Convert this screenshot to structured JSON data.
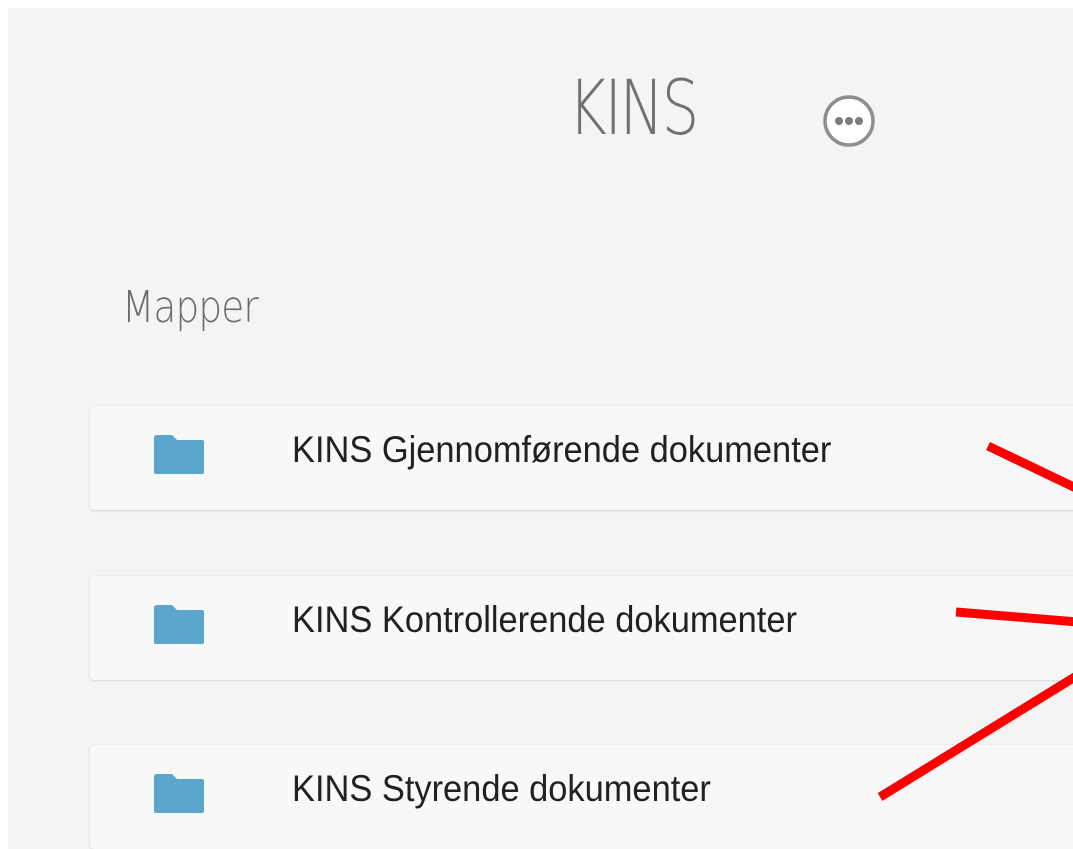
{
  "header": {
    "title": "KINS",
    "more_icon": "more-horizontal-circle-icon"
  },
  "folders_section": {
    "heading": "Mapper",
    "items": [
      {
        "label": "KINS Gjennomførende dokumenter",
        "icon": "folder-icon"
      },
      {
        "label": "KINS Kontrollerende dokumenter",
        "icon": "folder-icon"
      },
      {
        "label": "KINS Styrende dokumenter",
        "icon": "folder-icon"
      }
    ]
  },
  "colors": {
    "background": "#f4f4f4",
    "folder_icon": "#5aa6cc",
    "annotation_lines": "#ff0000",
    "title_text": "#707070"
  }
}
